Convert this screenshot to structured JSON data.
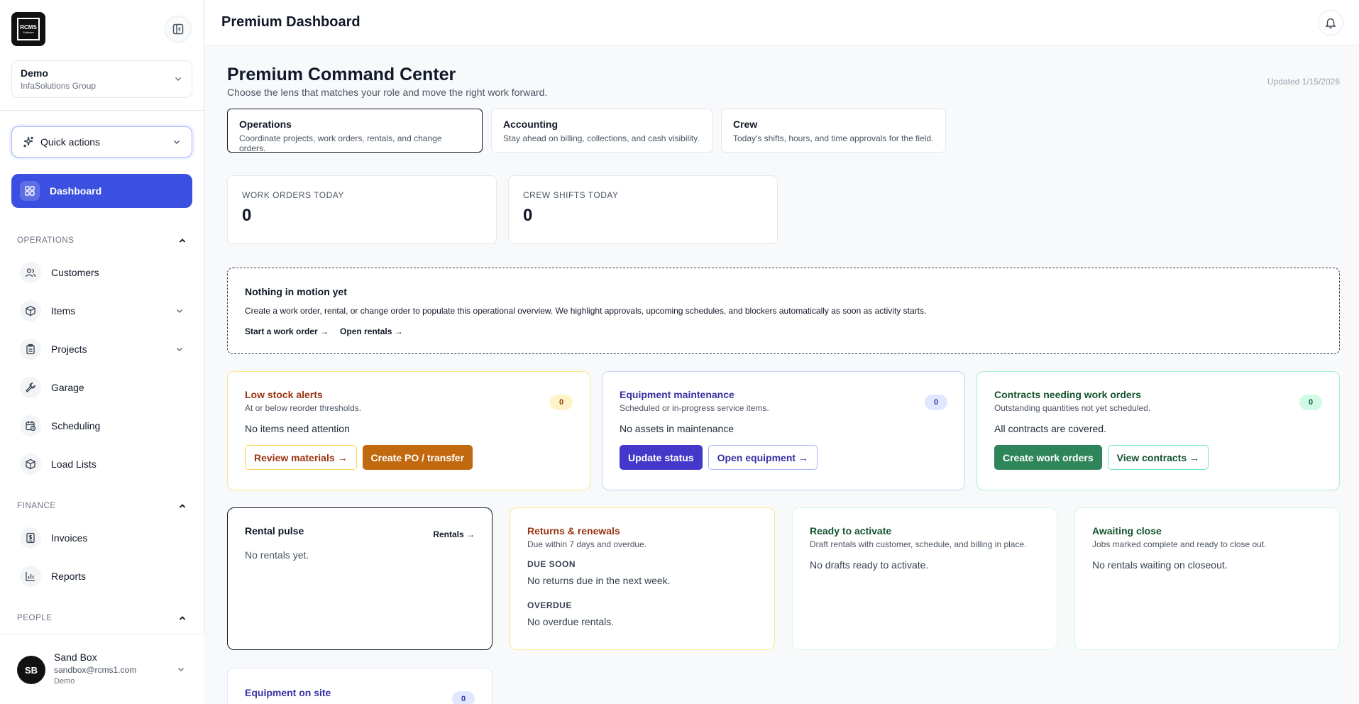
{
  "sidebar": {
    "logo_text": "RCMS",
    "logo_sub": "Software",
    "org": {
      "name": "Demo",
      "sub": "InfaSolutions Group"
    },
    "quick_actions": "Quick actions",
    "dashboard": "Dashboard",
    "sections": {
      "operations": "OPERATIONS",
      "finance": "FINANCE",
      "people": "PEOPLE"
    },
    "operations_items": [
      "Customers",
      "Items",
      "Projects",
      "Garage",
      "Scheduling",
      "Load Lists"
    ],
    "finance_items": [
      "Invoices",
      "Reports"
    ],
    "user": {
      "initials": "SB",
      "name": "Sand Box",
      "email": "sandbox@rcms1.com",
      "org": "Demo"
    }
  },
  "header": {
    "title": "Premium Dashboard"
  },
  "main": {
    "title": "Premium Command Center",
    "subtitle": "Choose the lens that matches your role and move the right work forward.",
    "updated": "Updated 1/15/2026",
    "lenses": [
      {
        "title": "Operations",
        "desc": "Coordinate projects, work orders, rentals, and change orders."
      },
      {
        "title": "Accounting",
        "desc": "Stay ahead on billing, collections, and cash visibility."
      },
      {
        "title": "Crew",
        "desc": "Today's shifts, hours, and time approvals for the field."
      }
    ],
    "stats": [
      {
        "label": "WORK ORDERS TODAY",
        "value": "0"
      },
      {
        "label": "CREW SHIFTS TODAY",
        "value": "0"
      }
    ],
    "empty": {
      "title": "Nothing in motion yet",
      "desc": "Create a work order, rental, or change order to populate this operational overview. We highlight approvals, upcoming schedules, and blockers automatically as soon as activity starts.",
      "link1": "Start a work order →",
      "link2": "Open rentals →"
    },
    "low_stock": {
      "title": "Low stock alerts",
      "sub": "At or below reorder thresholds.",
      "badge": "0",
      "msg": "No items need attention",
      "btn1": "Review materials →",
      "btn2": "Create PO / transfer"
    },
    "maintenance": {
      "title": "Equipment maintenance",
      "sub": "Scheduled or in-progress service items.",
      "badge": "0",
      "msg": "No assets in maintenance",
      "btn1": "Update status",
      "btn2": "Open equipment →"
    },
    "contracts": {
      "title": "Contracts needing work orders",
      "sub": "Outstanding quantities not yet scheduled.",
      "badge": "0",
      "msg": "All contracts are covered.",
      "btn1": "Create work orders",
      "btn2": "View contracts →"
    },
    "rental_pulse": {
      "title": "Rental pulse",
      "link": "Rentals →",
      "msg": "No rentals yet."
    },
    "returns": {
      "title": "Returns & renewals",
      "sub": "Due within 7 days and overdue.",
      "due_label": "DUE SOON",
      "due_msg": "No returns due in the next week.",
      "overdue_label": "OVERDUE",
      "overdue_msg": "No overdue rentals."
    },
    "ready": {
      "title": "Ready to activate",
      "sub": "Draft rentals with customer, schedule, and billing in place.",
      "msg": "No drafts ready to activate."
    },
    "awaiting": {
      "title": "Awaiting close",
      "sub": "Jobs marked complete and ready to close out.",
      "msg": "No rentals waiting on closeout."
    },
    "on_site": {
      "title": "Equipment on site",
      "badge": "0"
    }
  },
  "colors": {
    "primary": "#3b4fe0",
    "amber": "#c2680f",
    "green": "#2f855a",
    "indigo": "#4338ca"
  }
}
